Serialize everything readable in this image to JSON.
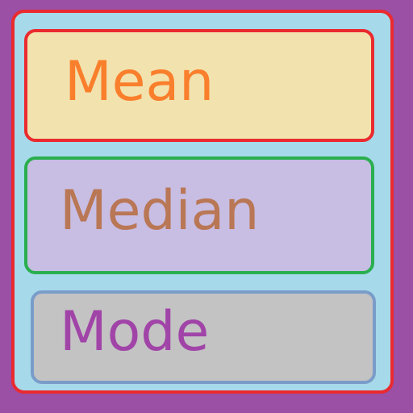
{
  "colors": {
    "background": "#9b4fa5",
    "panel_fill": "#a6d9ea",
    "panel_border": "#ea2a2e"
  },
  "cards": [
    {
      "label": "Mean",
      "fill": "#f2e2ae",
      "border": "#ea2a2e",
      "text_color": "#fa7f2c"
    },
    {
      "label": "Median",
      "fill": "#c8bde3",
      "border": "#2aaf4f",
      "text_color": "#b97755"
    },
    {
      "label": "Mode",
      "fill": "#c3c3c3",
      "border": "#7a9cc9",
      "text_color": "#a144a8"
    }
  ]
}
